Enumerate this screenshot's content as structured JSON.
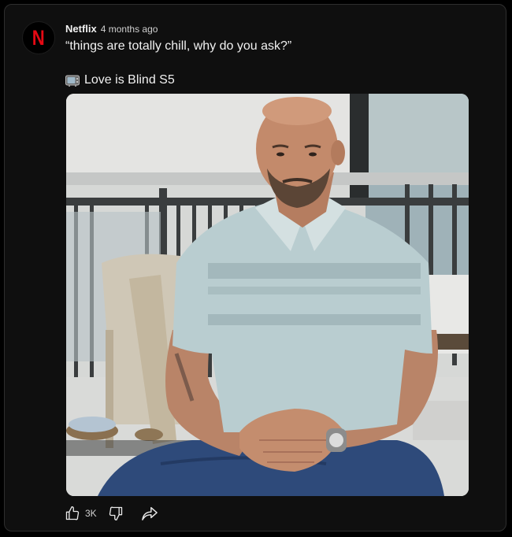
{
  "post": {
    "channel_name": "Netflix",
    "avatar_letter": "N",
    "time_ago": "4 months ago",
    "text": "“things are totally chill, why do you ask?”",
    "tag_icon": "tv-icon",
    "tag_text": "Love is Blind S5"
  },
  "actions": {
    "like_count": "3K",
    "like_icon": "thumbs-up-icon",
    "dislike_icon": "thumbs-down-icon",
    "share_icon": "share-icon"
  },
  "colors": {
    "background": "#0f0f0f",
    "brand_red": "#e50914",
    "text": "#f1f1f1"
  }
}
